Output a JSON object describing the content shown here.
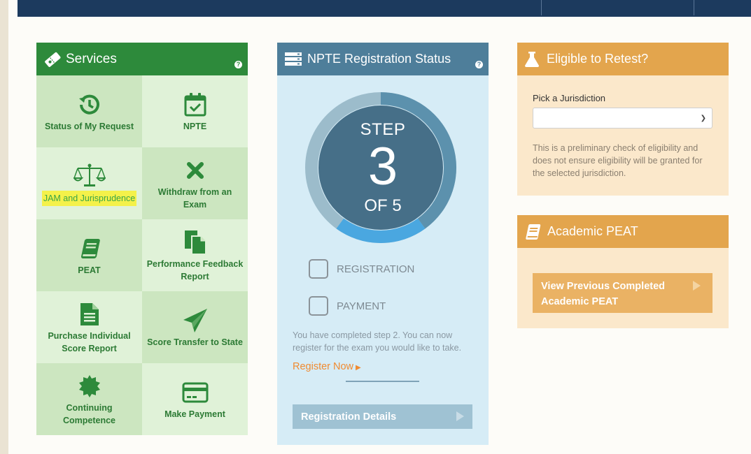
{
  "services": {
    "title": "Services",
    "help": "?",
    "tiles": [
      {
        "label": "Status of My Request",
        "icon": "history-icon"
      },
      {
        "label": "NPTE",
        "icon": "calendar-check-icon"
      },
      {
        "label": "JAM and Jurisprudence",
        "icon": "scales-icon"
      },
      {
        "label": "Withdraw from an Exam",
        "icon": "x-icon"
      },
      {
        "label": "PEAT",
        "icon": "book-icon"
      },
      {
        "label": "Performance Feedback Report",
        "icon": "document-copy-icon"
      },
      {
        "label": "Purchase Individual Score Report",
        "icon": "file-text-icon"
      },
      {
        "label": "Score Transfer to State",
        "icon": "paper-plane-icon"
      },
      {
        "label": "Continuing Competence",
        "icon": "certificate-icon"
      },
      {
        "label": "Make Payment",
        "icon": "credit-card-icon"
      }
    ]
  },
  "npte": {
    "title": "NPTE Registration Status",
    "help": "?",
    "step_word": "STEP",
    "step_number": "3",
    "step_of": "OF 5",
    "progress": {
      "current": 3,
      "total": 5
    },
    "checklist": [
      "REGISTRATION",
      "PAYMENT"
    ],
    "note": "You have completed step 2. You can now register for the exam you would like to take.",
    "register_link": "Register Now",
    "details_button": "Registration Details"
  },
  "retest": {
    "title": "Eligible to Retest?",
    "pick_label": "Pick a Jurisdiction",
    "selected": "",
    "note": "This is a preliminary check of eligibility and does not ensure eligibility will be granted for the selected jurisdiction."
  },
  "peat": {
    "title": "Academic PEAT",
    "button": "View Previous Completed Academic PEAT"
  },
  "colors": {
    "services_header": "#2d8a3b",
    "npte_header": "#4e7e9a",
    "retest_header": "#e3a54d",
    "link_orange": "#f08b31",
    "highlight": "#f4f14a"
  }
}
